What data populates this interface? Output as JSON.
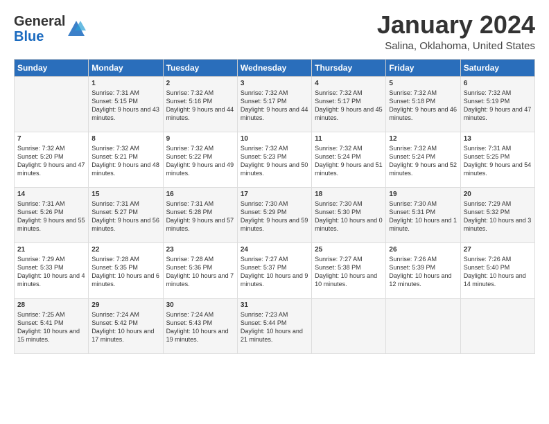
{
  "header": {
    "logo_general": "General",
    "logo_blue": "Blue",
    "month_title": "January 2024",
    "location": "Salina, Oklahoma, United States"
  },
  "days_of_week": [
    "Sunday",
    "Monday",
    "Tuesday",
    "Wednesday",
    "Thursday",
    "Friday",
    "Saturday"
  ],
  "weeks": [
    [
      {
        "day": "",
        "sunrise": "",
        "sunset": "",
        "daylight": ""
      },
      {
        "day": "1",
        "sunrise": "Sunrise: 7:31 AM",
        "sunset": "Sunset: 5:15 PM",
        "daylight": "Daylight: 9 hours and 43 minutes."
      },
      {
        "day": "2",
        "sunrise": "Sunrise: 7:32 AM",
        "sunset": "Sunset: 5:16 PM",
        "daylight": "Daylight: 9 hours and 44 minutes."
      },
      {
        "day": "3",
        "sunrise": "Sunrise: 7:32 AM",
        "sunset": "Sunset: 5:17 PM",
        "daylight": "Daylight: 9 hours and 44 minutes."
      },
      {
        "day": "4",
        "sunrise": "Sunrise: 7:32 AM",
        "sunset": "Sunset: 5:17 PM",
        "daylight": "Daylight: 9 hours and 45 minutes."
      },
      {
        "day": "5",
        "sunrise": "Sunrise: 7:32 AM",
        "sunset": "Sunset: 5:18 PM",
        "daylight": "Daylight: 9 hours and 46 minutes."
      },
      {
        "day": "6",
        "sunrise": "Sunrise: 7:32 AM",
        "sunset": "Sunset: 5:19 PM",
        "daylight": "Daylight: 9 hours and 47 minutes."
      }
    ],
    [
      {
        "day": "7",
        "sunrise": "Sunrise: 7:32 AM",
        "sunset": "Sunset: 5:20 PM",
        "daylight": "Daylight: 9 hours and 47 minutes."
      },
      {
        "day": "8",
        "sunrise": "Sunrise: 7:32 AM",
        "sunset": "Sunset: 5:21 PM",
        "daylight": "Daylight: 9 hours and 48 minutes."
      },
      {
        "day": "9",
        "sunrise": "Sunrise: 7:32 AM",
        "sunset": "Sunset: 5:22 PM",
        "daylight": "Daylight: 9 hours and 49 minutes."
      },
      {
        "day": "10",
        "sunrise": "Sunrise: 7:32 AM",
        "sunset": "Sunset: 5:23 PM",
        "daylight": "Daylight: 9 hours and 50 minutes."
      },
      {
        "day": "11",
        "sunrise": "Sunrise: 7:32 AM",
        "sunset": "Sunset: 5:24 PM",
        "daylight": "Daylight: 9 hours and 51 minutes."
      },
      {
        "day": "12",
        "sunrise": "Sunrise: 7:32 AM",
        "sunset": "Sunset: 5:24 PM",
        "daylight": "Daylight: 9 hours and 52 minutes."
      },
      {
        "day": "13",
        "sunrise": "Sunrise: 7:31 AM",
        "sunset": "Sunset: 5:25 PM",
        "daylight": "Daylight: 9 hours and 54 minutes."
      }
    ],
    [
      {
        "day": "14",
        "sunrise": "Sunrise: 7:31 AM",
        "sunset": "Sunset: 5:26 PM",
        "daylight": "Daylight: 9 hours and 55 minutes."
      },
      {
        "day": "15",
        "sunrise": "Sunrise: 7:31 AM",
        "sunset": "Sunset: 5:27 PM",
        "daylight": "Daylight: 9 hours and 56 minutes."
      },
      {
        "day": "16",
        "sunrise": "Sunrise: 7:31 AM",
        "sunset": "Sunset: 5:28 PM",
        "daylight": "Daylight: 9 hours and 57 minutes."
      },
      {
        "day": "17",
        "sunrise": "Sunrise: 7:30 AM",
        "sunset": "Sunset: 5:29 PM",
        "daylight": "Daylight: 9 hours and 59 minutes."
      },
      {
        "day": "18",
        "sunrise": "Sunrise: 7:30 AM",
        "sunset": "Sunset: 5:30 PM",
        "daylight": "Daylight: 10 hours and 0 minutes."
      },
      {
        "day": "19",
        "sunrise": "Sunrise: 7:30 AM",
        "sunset": "Sunset: 5:31 PM",
        "daylight": "Daylight: 10 hours and 1 minute."
      },
      {
        "day": "20",
        "sunrise": "Sunrise: 7:29 AM",
        "sunset": "Sunset: 5:32 PM",
        "daylight": "Daylight: 10 hours and 3 minutes."
      }
    ],
    [
      {
        "day": "21",
        "sunrise": "Sunrise: 7:29 AM",
        "sunset": "Sunset: 5:33 PM",
        "daylight": "Daylight: 10 hours and 4 minutes."
      },
      {
        "day": "22",
        "sunrise": "Sunrise: 7:28 AM",
        "sunset": "Sunset: 5:35 PM",
        "daylight": "Daylight: 10 hours and 6 minutes."
      },
      {
        "day": "23",
        "sunrise": "Sunrise: 7:28 AM",
        "sunset": "Sunset: 5:36 PM",
        "daylight": "Daylight: 10 hours and 7 minutes."
      },
      {
        "day": "24",
        "sunrise": "Sunrise: 7:27 AM",
        "sunset": "Sunset: 5:37 PM",
        "daylight": "Daylight: 10 hours and 9 minutes."
      },
      {
        "day": "25",
        "sunrise": "Sunrise: 7:27 AM",
        "sunset": "Sunset: 5:38 PM",
        "daylight": "Daylight: 10 hours and 10 minutes."
      },
      {
        "day": "26",
        "sunrise": "Sunrise: 7:26 AM",
        "sunset": "Sunset: 5:39 PM",
        "daylight": "Daylight: 10 hours and 12 minutes."
      },
      {
        "day": "27",
        "sunrise": "Sunrise: 7:26 AM",
        "sunset": "Sunset: 5:40 PM",
        "daylight": "Daylight: 10 hours and 14 minutes."
      }
    ],
    [
      {
        "day": "28",
        "sunrise": "Sunrise: 7:25 AM",
        "sunset": "Sunset: 5:41 PM",
        "daylight": "Daylight: 10 hours and 15 minutes."
      },
      {
        "day": "29",
        "sunrise": "Sunrise: 7:24 AM",
        "sunset": "Sunset: 5:42 PM",
        "daylight": "Daylight: 10 hours and 17 minutes."
      },
      {
        "day": "30",
        "sunrise": "Sunrise: 7:24 AM",
        "sunset": "Sunset: 5:43 PM",
        "daylight": "Daylight: 10 hours and 19 minutes."
      },
      {
        "day": "31",
        "sunrise": "Sunrise: 7:23 AM",
        "sunset": "Sunset: 5:44 PM",
        "daylight": "Daylight: 10 hours and 21 minutes."
      },
      {
        "day": "",
        "sunrise": "",
        "sunset": "",
        "daylight": ""
      },
      {
        "day": "",
        "sunrise": "",
        "sunset": "",
        "daylight": ""
      },
      {
        "day": "",
        "sunrise": "",
        "sunset": "",
        "daylight": ""
      }
    ]
  ]
}
